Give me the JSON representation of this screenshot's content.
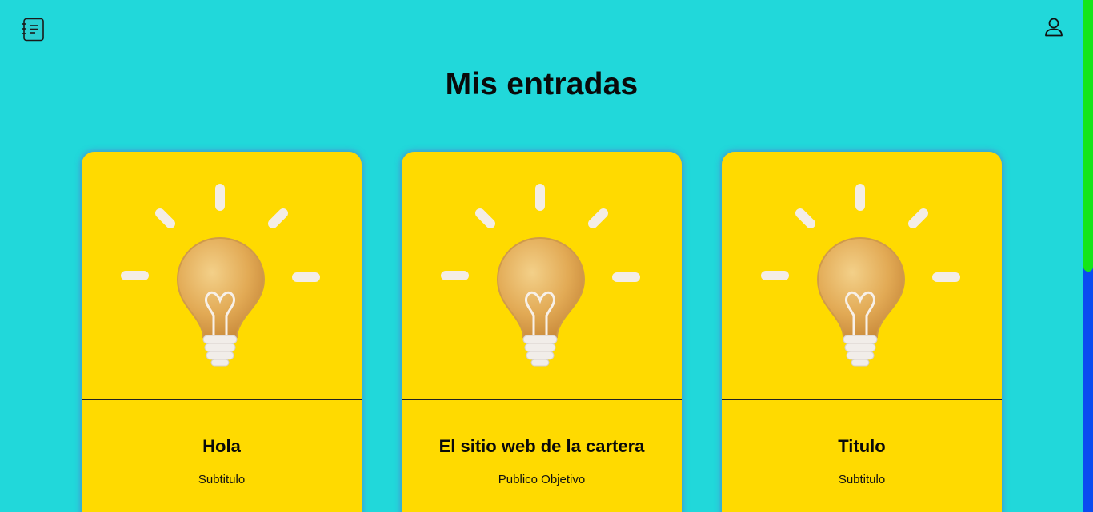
{
  "header": {
    "logo_icon": "notebook-icon",
    "user_icon": "user-icon"
  },
  "page": {
    "title": "Mis entradas"
  },
  "cards": [
    {
      "title": "Hola",
      "subtitle": "Subtitulo",
      "image_icon": "light-bulb-icon"
    },
    {
      "title": "El sitio web de la cartera",
      "subtitle": "Publico Objetivo",
      "image_icon": "light-bulb-icon"
    },
    {
      "title": "Titulo",
      "subtitle": "Subtitulo",
      "image_icon": "light-bulb-icon"
    }
  ],
  "colors": {
    "background": "#21d8da",
    "card": "#ffda00",
    "scrollbar_track": "#0a4cf0",
    "scrollbar_thumb": "#14e61a"
  }
}
